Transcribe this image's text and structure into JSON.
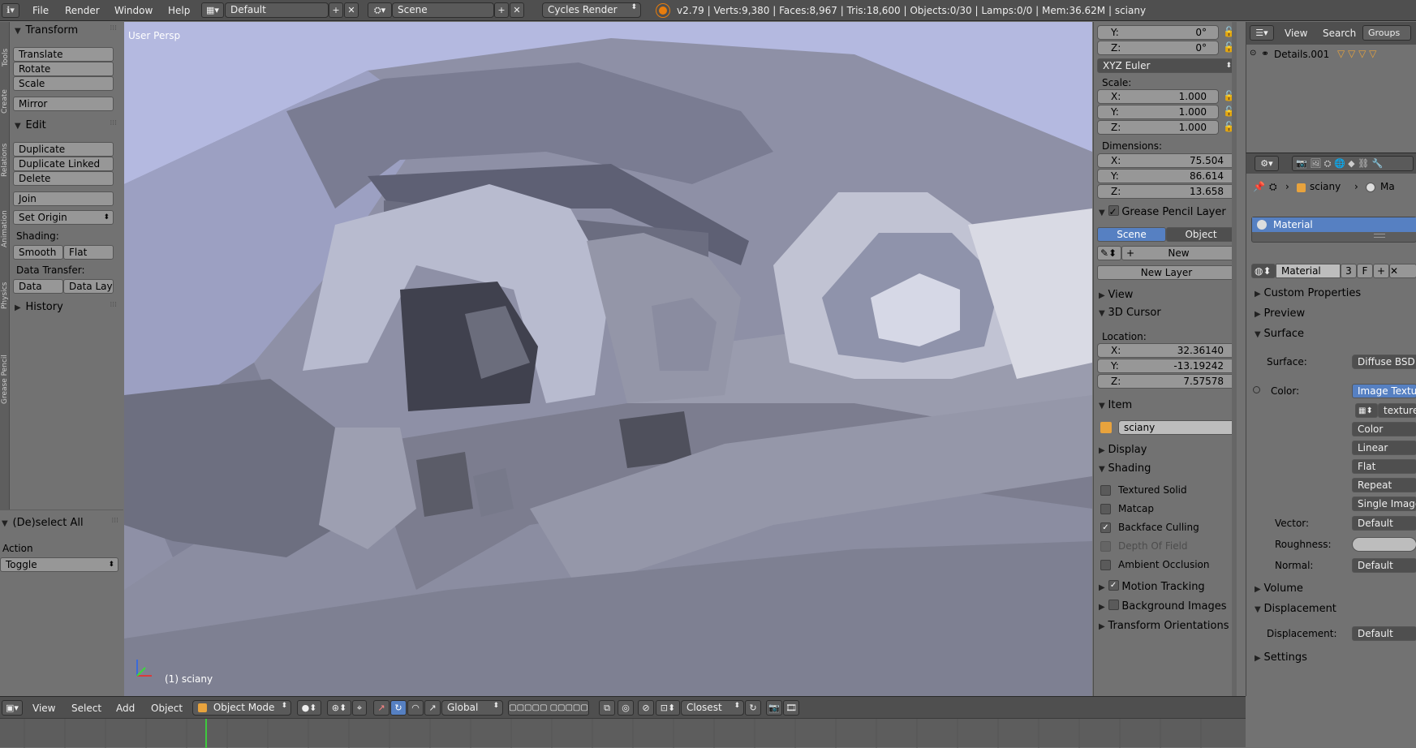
{
  "topbar": {
    "menu": [
      "File",
      "Render",
      "Window",
      "Help"
    ],
    "layout": "Default",
    "scene": "Scene",
    "engine": "Cycles Render",
    "stats": "v2.79 | Verts:9,380 | Faces:8,967 | Tris:18,600 | Objects:0/30 | Lamps:0/0 | Mem:36.62M | sciany"
  },
  "toolshelf": {
    "transform_title": "Transform",
    "transform_buttons": [
      "Translate",
      "Rotate",
      "Scale",
      "Mirror"
    ],
    "edit_title": "Edit",
    "edit_buttons": [
      "Duplicate",
      "Duplicate Linked",
      "Delete",
      "Join"
    ],
    "set_origin": "Set Origin",
    "shading_label": "Shading:",
    "shading_buttons": [
      "Smooth",
      "Flat"
    ],
    "data_transfer_label": "Data Transfer:",
    "data_transfer_buttons": [
      "Data",
      "Data Layo"
    ],
    "history_title": "History",
    "tabs": [
      "Tools",
      "Create",
      "Relations",
      "Animation",
      "Physics",
      "Grease Pencil"
    ]
  },
  "operator": {
    "title": "(De)select All",
    "action_label": "Action",
    "action_value": "Toggle"
  },
  "viewport": {
    "view_name": "User Persp",
    "object_label": "(1) sciany"
  },
  "npanel": {
    "rotation": [
      {
        "axis": "Y:",
        "value": "0°"
      },
      {
        "axis": "Z:",
        "value": "0°"
      }
    ],
    "rotation_mode": "XYZ Euler",
    "scale_label": "Scale:",
    "scale": [
      {
        "axis": "X:",
        "value": "1.000"
      },
      {
        "axis": "Y:",
        "value": "1.000"
      },
      {
        "axis": "Z:",
        "value": "1.000"
      }
    ],
    "dimensions_label": "Dimensions:",
    "dimensions": [
      {
        "axis": "X:",
        "value": "75.504"
      },
      {
        "axis": "Y:",
        "value": "86.614"
      },
      {
        "axis": "Z:",
        "value": "13.658"
      }
    ],
    "grease_pencil_title": "Grease Pencil Layer",
    "gp_tabs": [
      "Scene",
      "Object"
    ],
    "gp_new": "New",
    "gp_new_layer": "New Layer",
    "view_title": "View",
    "cursor_title": "3D Cursor",
    "location_label": "Location:",
    "cursor_location": [
      {
        "axis": "X:",
        "value": "32.36140"
      },
      {
        "axis": "Y:",
        "value": "-13.19242"
      },
      {
        "axis": "Z:",
        "value": "7.57578"
      }
    ],
    "item_title": "Item",
    "item_name": "sciany",
    "display_title": "Display",
    "shading_title": "Shading",
    "shading_options": [
      {
        "label": "Textured Solid",
        "checked": false,
        "disabled": false
      },
      {
        "label": "Matcap",
        "checked": false,
        "disabled": false
      },
      {
        "label": "Backface Culling",
        "checked": true,
        "disabled": false
      },
      {
        "label": "Depth Of Field",
        "checked": false,
        "disabled": true
      },
      {
        "label": "Ambient Occlusion",
        "checked": false,
        "disabled": false
      }
    ],
    "motion_tracking": "Motion Tracking",
    "background_images": "Background Images",
    "transform_orientations": "Transform Orientations"
  },
  "outliner": {
    "menu": [
      "View",
      "Search"
    ],
    "groups": "Groups",
    "item": "Details.001"
  },
  "properties": {
    "breadcrumb_object": "sciany",
    "breadcrumb_mat": "Ma",
    "material_slot": "Material",
    "material_name": "Material",
    "material_users": "3",
    "material_fake": "F",
    "sections": {
      "custom_properties": "Custom Properties",
      "preview": "Preview",
      "surface": "Surface",
      "volume": "Volume",
      "displacement": "Displacement",
      "settings": "Settings"
    },
    "surface_label": "Surface:",
    "surface_value": "Diffuse BSD",
    "color_label": "Color:",
    "color_value": "Image Textu",
    "texture_value": "texture",
    "tex_options": [
      "Color",
      "Linear",
      "Flat",
      "Repeat",
      "Single Image"
    ],
    "vector_label": "Vector:",
    "vector_value": "Default",
    "roughness_label": "Roughness:",
    "normal_label": "Normal:",
    "normal_value": "Default",
    "displacement_label": "Displacement:",
    "displacement_value": "Default"
  },
  "bottombar": {
    "menu": [
      "View",
      "Select",
      "Add",
      "Object"
    ],
    "mode": "Object Mode",
    "orientation": "Global",
    "snap": "Closest"
  },
  "colors": {
    "header": "#4f4f4f",
    "panel": "#727272",
    "selected": "#5680c2",
    "viewport_sky": "#aeb3dc"
  }
}
